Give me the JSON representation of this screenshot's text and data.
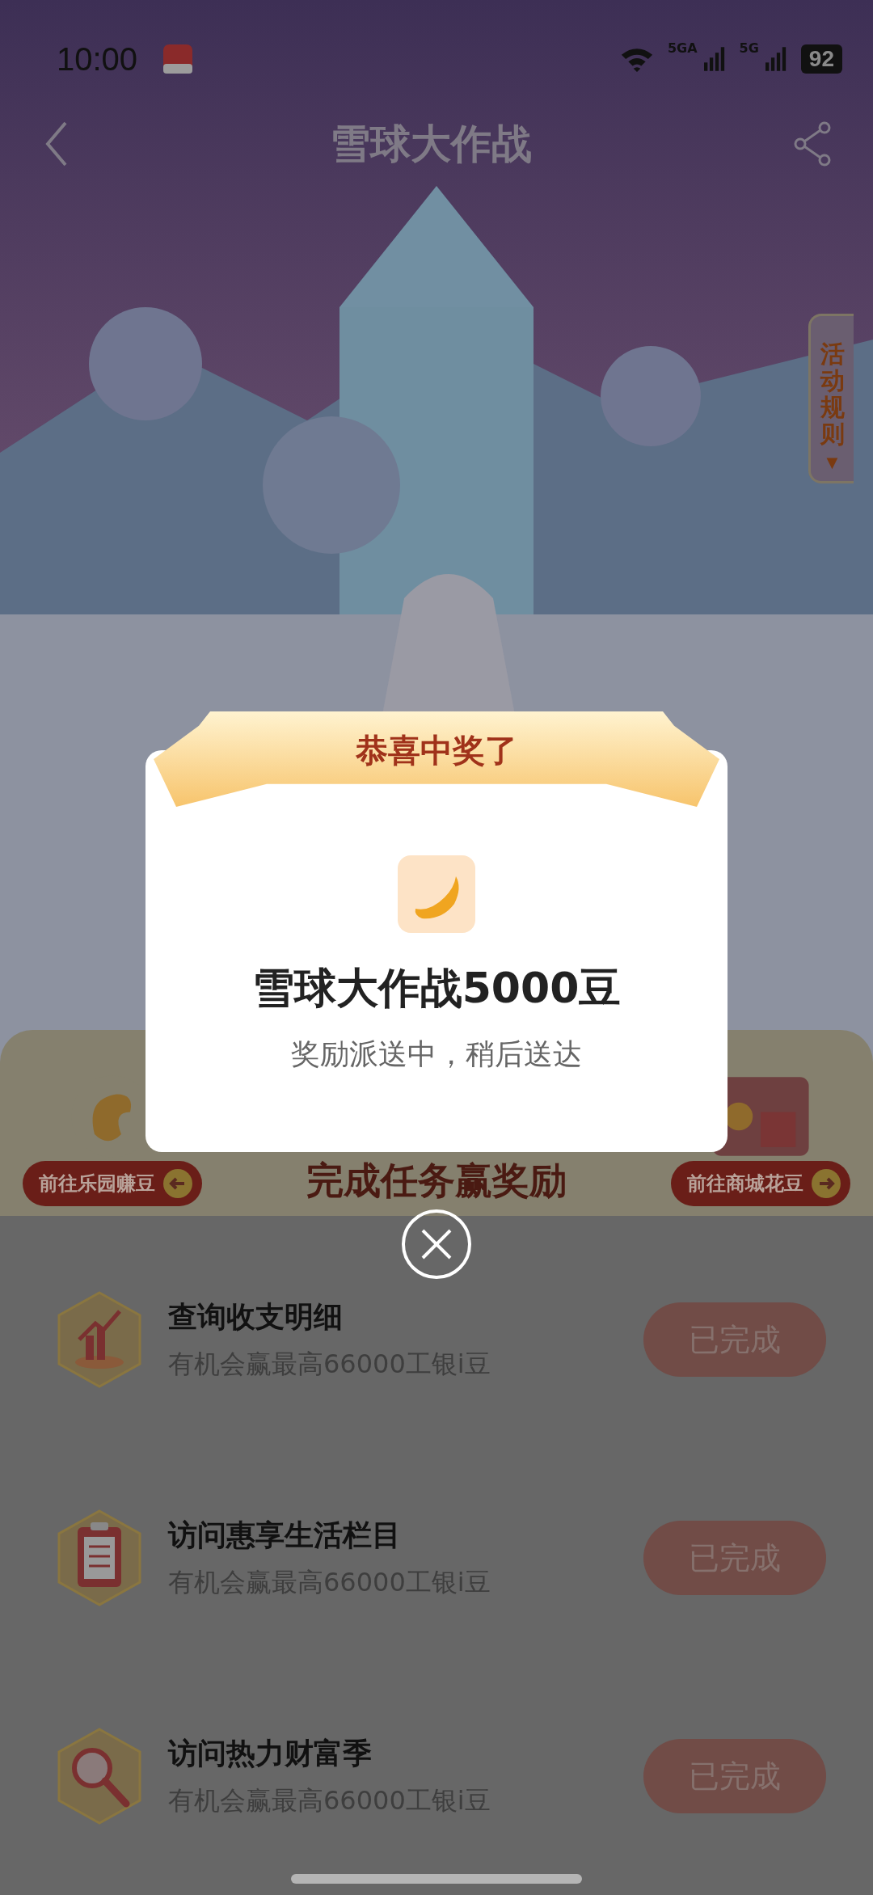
{
  "status_bar": {
    "time": "10:00",
    "network_1": "5GA",
    "network_2": "5G",
    "battery": "92"
  },
  "nav": {
    "title": "雪球大作战"
  },
  "side_tab": {
    "label": "活动规则",
    "arrow": "▼"
  },
  "section": {
    "title": "完成任务赢奖励",
    "left_button": "前往乐园赚豆",
    "right_button": "前往商城花豆"
  },
  "tasks": [
    {
      "kind": "chart",
      "title": "查询收支明细",
      "subtitle": "有机会赢最高66000工银i豆",
      "button": "已完成",
      "done": true
    },
    {
      "kind": "clipboard",
      "title": "访问惠享生活栏目",
      "subtitle": "有机会赢最高66000工银i豆",
      "button": "已完成",
      "done": true
    },
    {
      "kind": "magnifier",
      "title": "访问热力财富季",
      "subtitle": "有机会赢最高66000工银i豆",
      "button": "已完成",
      "done": true
    }
  ],
  "dialog": {
    "ribbon": "恭喜中奖了",
    "title": "雪球大作战5000豆",
    "message": "奖励派送中，稍后送达"
  }
}
